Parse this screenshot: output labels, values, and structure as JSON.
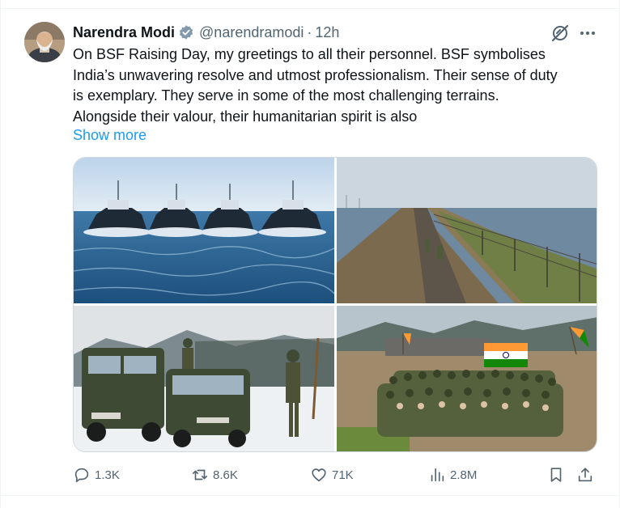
{
  "tweet": {
    "author": {
      "name": "Narendra Modi",
      "handle": "@narendramodi",
      "separator": "·",
      "time": "12h"
    },
    "text_lines": [
      "On BSF Raising Day, my greetings to all their personnel. BSF symbolises",
      "India’s unwavering resolve and utmost professionalism. Their sense of duty",
      "is exemplary. They serve in some of the most challenging terrains.",
      "Alongside their valour, their humanitarian spirit is also"
    ],
    "show_more": "Show more",
    "media": [
      {
        "subject": "patrol-boats"
      },
      {
        "subject": "border-fence-patrol"
      },
      {
        "subject": "snow-vehicles"
      },
      {
        "subject": "group-with-flags"
      }
    ],
    "metrics": {
      "replies": "1.3K",
      "reposts": "8.6K",
      "likes": "71K",
      "views": "2.8M"
    }
  },
  "icons": {
    "verified": "verified-badge-icon",
    "grok": "grok-icon",
    "more": "more-dots-icon",
    "reply": "reply-icon",
    "repost": "repost-icon",
    "like": "heart-icon",
    "views": "views-chart-icon",
    "bookmark": "bookmark-icon",
    "share": "share-icon"
  },
  "colors": {
    "text_primary": "#0f1419",
    "text_secondary": "#536471",
    "link": "#1d9bf0",
    "border": "#cfd9de"
  }
}
